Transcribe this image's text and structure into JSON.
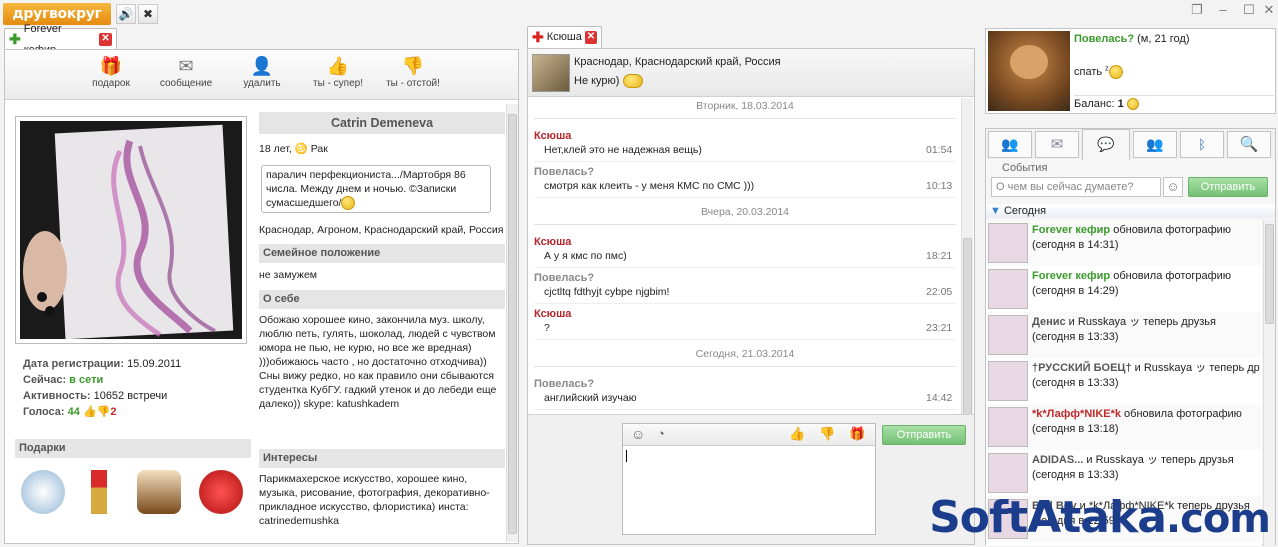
{
  "app": {
    "logo": "другвокруг",
    "sound_icon": "speaker-icon",
    "settings_icon": "tools-icon"
  },
  "window_controls": [
    "restore-icon",
    "minimize-icon",
    "maximize-icon",
    "close-icon"
  ],
  "profile_tab": {
    "title": "Forever кефир",
    "actions": [
      {
        "label": "подарок",
        "icon": "gift-icon"
      },
      {
        "label": "сообщение",
        "icon": "envelope-icon"
      },
      {
        "label": "удалить",
        "icon": "delete-user-icon"
      },
      {
        "label": "ты - супер!",
        "icon": "thumbs-up-icon"
      },
      {
        "label": "ты - отстой!",
        "icon": "thumbs-down-icon"
      }
    ],
    "name": "Catrin Demeneva",
    "age_sign": "18 лет,",
    "zodiac": "Рак",
    "status": "паралич перфекциониста.../Мартобря 86 числа. Между днем и ночью. ©Записки сумасшедшего/",
    "location": "Краснодар, Агроном, Краснодарский край, Россия",
    "family_header": "Семейное положение",
    "family_value": "не замужем",
    "about_header": "О себе",
    "about_text": "Обожаю хорошее кино, закончила муз. школу, люблю петь, гулять, шоколад, людей с чувством юмора не пью, не курю, но все же вредная) )))обижаюсь часто , но достаточно отходчива)) Сны вижу редко, но как правило они сбываются студентка КубГУ. гадкий утенок и до лебеди еще далеко)) skype: katushkadem",
    "interests_header": "Интересы",
    "interests_text": "Парикмахерское искусство, хорошее кино, музыка, рисование, фотография, декоративно-прикладное искусство, флористика) инста: catrinedemushka",
    "reg_label": "Дата регистрации:",
    "reg_value": "15.09.2011",
    "now_label": "Сейчас:",
    "now_value": "в сети",
    "activity_label": "Активность:",
    "activity_value": "10652 встречи",
    "votes_label": "Голоса:",
    "votes_up": "44",
    "votes_down": "2",
    "gifts_header": "Подарки"
  },
  "chat_tab": {
    "title": "Ксюша",
    "location": "Краснодар, Краснодарский край, Россия",
    "status": "Не курю)",
    "messages": [
      {
        "type": "date",
        "text": "Вторник, 18.03.2014"
      },
      {
        "type": "msg",
        "author": "Ксюша",
        "text": "Нет,клей это не надежная вещь)",
        "time": "01:54",
        "me": false
      },
      {
        "type": "msg",
        "author": "Повелась?",
        "text": "смотря как клеить - у меня КМС по СМС )))",
        "time": "10:13",
        "me": true
      },
      {
        "type": "date",
        "text": "Вчера, 20.03.2014"
      },
      {
        "type": "msg",
        "author": "Ксюша",
        "text": "А у я кмс по пмс)",
        "time": "18:21",
        "me": false
      },
      {
        "type": "msg",
        "author": "Повелась?",
        "text": "cjctltq fdthyjt cybpe njgbim!",
        "time": "22:05",
        "me": true
      },
      {
        "type": "msg",
        "author": "Ксюша",
        "text": "?",
        "time": "23:21",
        "me": false
      },
      {
        "type": "date",
        "text": "Сегодня, 21.03.2014"
      },
      {
        "type": "msg",
        "author": "Повелась?",
        "text": "английский изучаю",
        "time": "14:42",
        "me": true
      }
    ],
    "send_label": "Отправить"
  },
  "me": {
    "name": "Повелась?",
    "meta": "(м, 21 год)",
    "status": "спать",
    "balance_label": "Баланс:",
    "balance_value": "1"
  },
  "events": {
    "header": "События",
    "placeholder": "О чем вы сейчас думаете?",
    "send_label": "Отправить",
    "group": "Сегодня",
    "items": [
      {
        "user": "Forever кефир",
        "action": "обновила фотографию",
        "time": "(сегодня в 14:31)",
        "color": "green"
      },
      {
        "user": "Forever кефир",
        "action": "обновила фотографию",
        "time": "(сегодня в 14:29)",
        "color": "green"
      },
      {
        "user": "Денис",
        "action": "и Russkaya ッ теперь друзья",
        "time": "(сегодня в 13:33)",
        "color": "gray"
      },
      {
        "user": "†РУССКИЙ БОЕЦ†",
        "action": "и Russkaya ッ теперь друзья",
        "time": "(сегодня в 13:33)",
        "color": "gray"
      },
      {
        "user": "*k*Лафф*NIKE*k",
        "action": "обновила фотографию",
        "time": "(сегодня в 13:18)",
        "color": "red"
      },
      {
        "user": "ADIDAS...",
        "action": "и Russkaya ッ теперь друзья",
        "time": "(сегодня в 13:33)",
        "color": "gray"
      },
      {
        "user": "Bad Boy",
        "action": "и *k*Лафф*NIKE*k теперь друзья",
        "time": "(сегодня в 12:59)",
        "color": "gray"
      }
    ]
  },
  "watermark": {
    "text": "SoftAtaka",
    "suffix": ".com"
  },
  "colors": {
    "accent_green": "#3a9a2a",
    "accent_red": "#b4262c",
    "logo_orange": "#e58a10"
  }
}
